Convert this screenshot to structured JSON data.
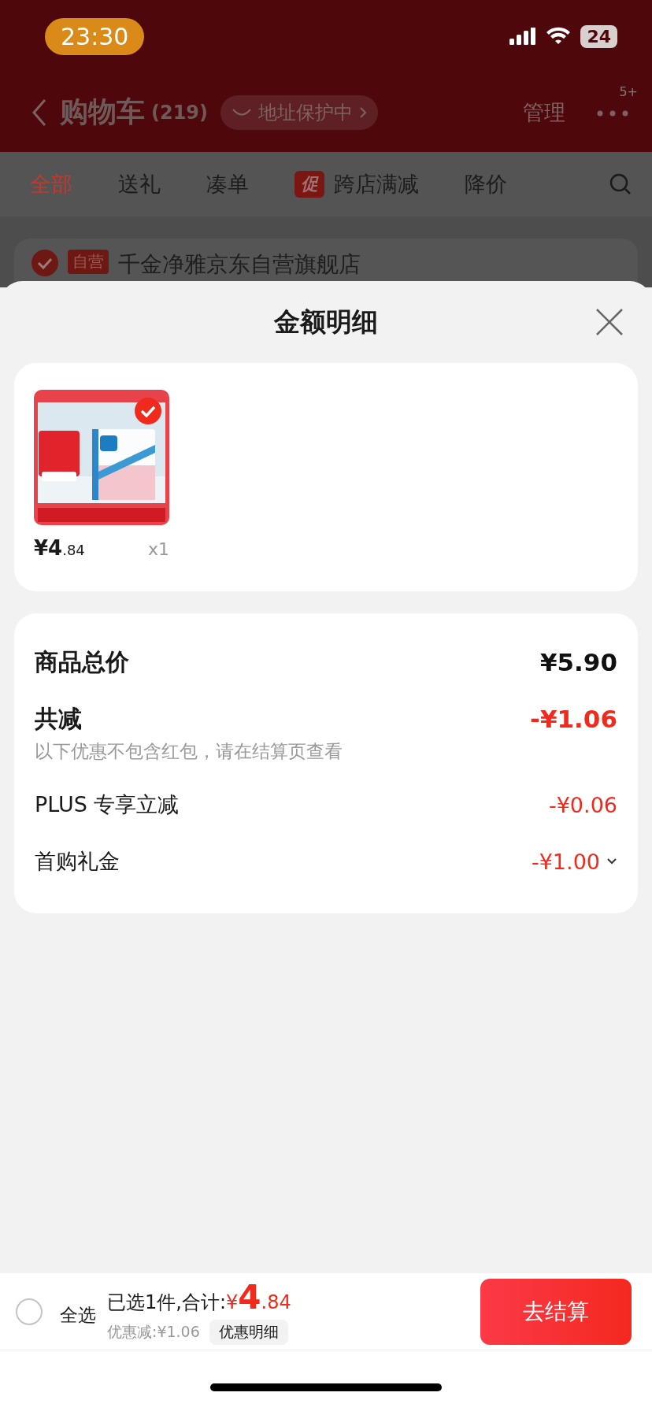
{
  "status_bar": {
    "time": "23:30",
    "battery": "24"
  },
  "nav": {
    "title": "购物车",
    "count": "(219)",
    "address_badge": "地址保护中",
    "manage": "管理",
    "more_badge": "5+"
  },
  "tabs": [
    {
      "label": "全部",
      "selected": true
    },
    {
      "label": "送礼",
      "selected": false
    },
    {
      "label": "凑单",
      "selected": false
    },
    {
      "label": "跨店满减",
      "selected": false,
      "badge": "促"
    },
    {
      "label": "降价",
      "selected": false
    }
  ],
  "store": {
    "badge": "自营",
    "name": "千金净雅京东自营旗舰店",
    "checked": true
  },
  "sheet": {
    "title": "金额明细"
  },
  "items": [
    {
      "kind": "picture",
      "selected": true,
      "price_int": "¥4",
      "price_dec": ".84",
      "quantity": "x1"
    }
  ],
  "summary": {
    "total_label": "商品总价",
    "total_value": "¥5.90",
    "discount_label": "共减",
    "discount_value": "-¥1.06",
    "note": "以下优惠不包含红包，请在结算页查看",
    "lines": [
      {
        "label": "PLUS 专享立减",
        "value": "-¥0.06",
        "expandable": false
      },
      {
        "label": "首购礼金",
        "value": "-¥1.00",
        "expandable": true
      }
    ]
  },
  "footer": {
    "select_all_label": "全选",
    "select_all_checked": false,
    "selected_text": "已选1件,合计:",
    "currency": "¥",
    "total_int": "4",
    "total_dec": ".84",
    "discount_text": "优惠减:¥1.06",
    "detail_button": "优惠明细",
    "checkout": "去结算"
  }
}
